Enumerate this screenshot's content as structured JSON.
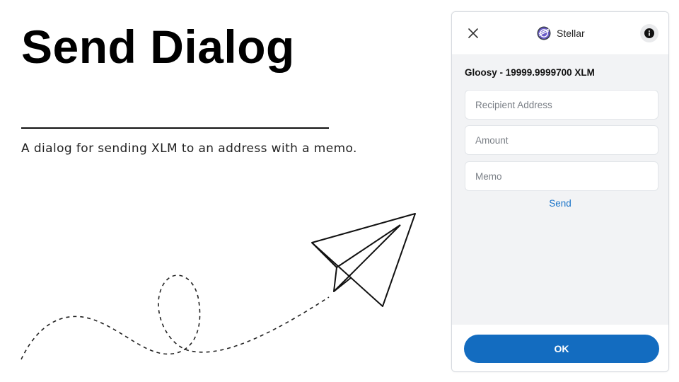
{
  "slide": {
    "title": "Send Dialog",
    "description": "A dialog for sending XLM to an address with a memo."
  },
  "dialog": {
    "brand_name": "Stellar",
    "account_line": "Gloosy - 19999.9999700 XLM",
    "recipient_placeholder": "Recipient Address",
    "amount_placeholder": "Amount",
    "memo_placeholder": "Memo",
    "send_label": "Send",
    "ok_label": "OK"
  },
  "colors": {
    "accent": "#136cc0",
    "link": "#1a73c8",
    "panel_bg": "#f2f3f5"
  },
  "icons": {
    "close": "close-icon",
    "brand": "stellar-logo-icon",
    "info": "info-icon",
    "illustration": "paper-plane-icon"
  }
}
